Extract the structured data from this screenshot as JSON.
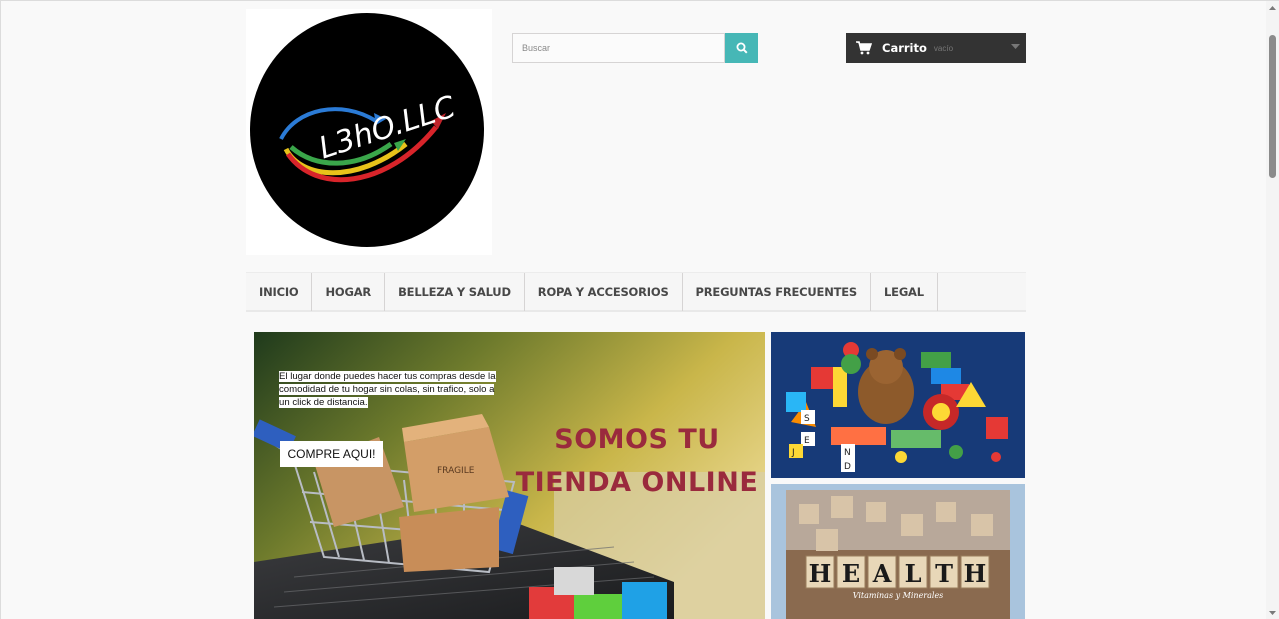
{
  "brand": {
    "logo_text": "L3hO.LLC"
  },
  "search": {
    "placeholder": "Buscar"
  },
  "cart": {
    "label": "Carrito",
    "status": "vacío"
  },
  "nav": {
    "items": [
      {
        "label": "INICIO"
      },
      {
        "label": "HOGAR"
      },
      {
        "label": "BELLEZA Y SALUD"
      },
      {
        "label": "ROPA Y ACCESORIOS"
      },
      {
        "label": "PREGUNTAS FRECUENTES"
      },
      {
        "label": "LEGAL"
      }
    ]
  },
  "hero": {
    "promo_text": "El lugar donde puedes hacer tus compras desde la comodidad de tu hogar sin colas, sin trafico, solo a un click de distancia.",
    "cta_label": "COMPRE AQUI!",
    "headline_line1": "SOMOS TU",
    "headline_line2": "TIENDA ONLINE",
    "box_label": "FRAGILE"
  },
  "side_banners": {
    "toys_letters": [
      "E",
      "N",
      "D",
      "S",
      "J"
    ],
    "health_letters": [
      "H",
      "E",
      "A",
      "L",
      "T",
      "H"
    ],
    "health_subtitle": "Vitaminas y Minerales"
  },
  "colors": {
    "accent": "#46b7b6",
    "cart_bg": "#333333",
    "headline": "#9a2a3d"
  }
}
